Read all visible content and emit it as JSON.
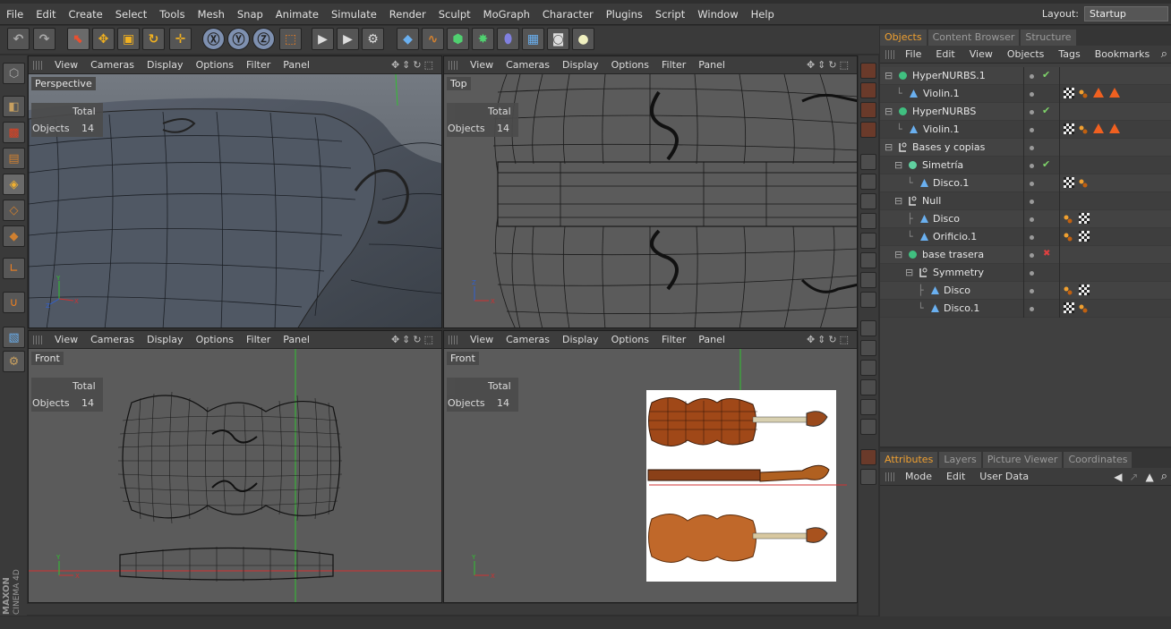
{
  "menu": [
    "File",
    "Edit",
    "Create",
    "Select",
    "Tools",
    "Mesh",
    "Snap",
    "Animate",
    "Simulate",
    "Render",
    "Sculpt",
    "MoGraph",
    "Character",
    "Plugins",
    "Script",
    "Window",
    "Help"
  ],
  "layout": {
    "label": "Layout:",
    "value": "Startup"
  },
  "viewport_menu": [
    "View",
    "Cameras",
    "Display",
    "Options",
    "Filter",
    "Panel"
  ],
  "viewports": [
    {
      "name": "Perspective",
      "hud_total": "Total",
      "hud_objects": "Objects",
      "hud_count": "14"
    },
    {
      "name": "Top",
      "hud_total": "Total",
      "hud_objects": "Objects",
      "hud_count": "14"
    },
    {
      "name": "Front",
      "hud_total": "Total",
      "hud_objects": "Objects",
      "hud_count": "14"
    },
    {
      "name": "Front",
      "hud_total": "Total",
      "hud_objects": "Objects",
      "hud_count": "14"
    }
  ],
  "axis": {
    "x": "X",
    "y": "Y",
    "z": "Z"
  },
  "object_tabs": [
    "Objects",
    "Content Browser",
    "Structure"
  ],
  "object_menu": [
    "File",
    "Edit",
    "View",
    "Objects",
    "Tags",
    "Bookmarks"
  ],
  "tree": [
    {
      "label": "HyperNURBS.1",
      "icon": "hypernurbs-icon"
    },
    {
      "label": "Violin.1",
      "icon": "polygon-icon"
    },
    {
      "label": "HyperNURBS",
      "icon": "hypernurbs-icon"
    },
    {
      "label": "Violin.1",
      "icon": "polygon-icon"
    },
    {
      "label": "Bases y copias",
      "icon": "null-icon"
    },
    {
      "label": "Simetría",
      "icon": "symmetry-icon"
    },
    {
      "label": "Disco.1",
      "icon": "polygon-icon"
    },
    {
      "label": "Null",
      "icon": "null-icon"
    },
    {
      "label": "Disco",
      "icon": "polygon-icon"
    },
    {
      "label": "Orificio.1",
      "icon": "polygon-icon"
    },
    {
      "label": "base trasera",
      "icon": "hypernurbs-icon"
    },
    {
      "label": "Symmetry",
      "icon": "null-icon"
    },
    {
      "label": "Disco",
      "icon": "polygon-icon"
    },
    {
      "label": "Disco.1",
      "icon": "polygon-icon"
    }
  ],
  "attr_tabs": [
    "Attributes",
    "Layers",
    "Picture Viewer",
    "Coordinates"
  ],
  "attr_menu": [
    "Mode",
    "Edit",
    "User Data"
  ],
  "brand": {
    "maxon": "MAXON",
    "product": "CINEMA 4D"
  },
  "colors": {
    "accent": "#f0a030",
    "axis_x": "#d03030",
    "axis_y": "#30c030",
    "axis_z": "#3060d0"
  }
}
